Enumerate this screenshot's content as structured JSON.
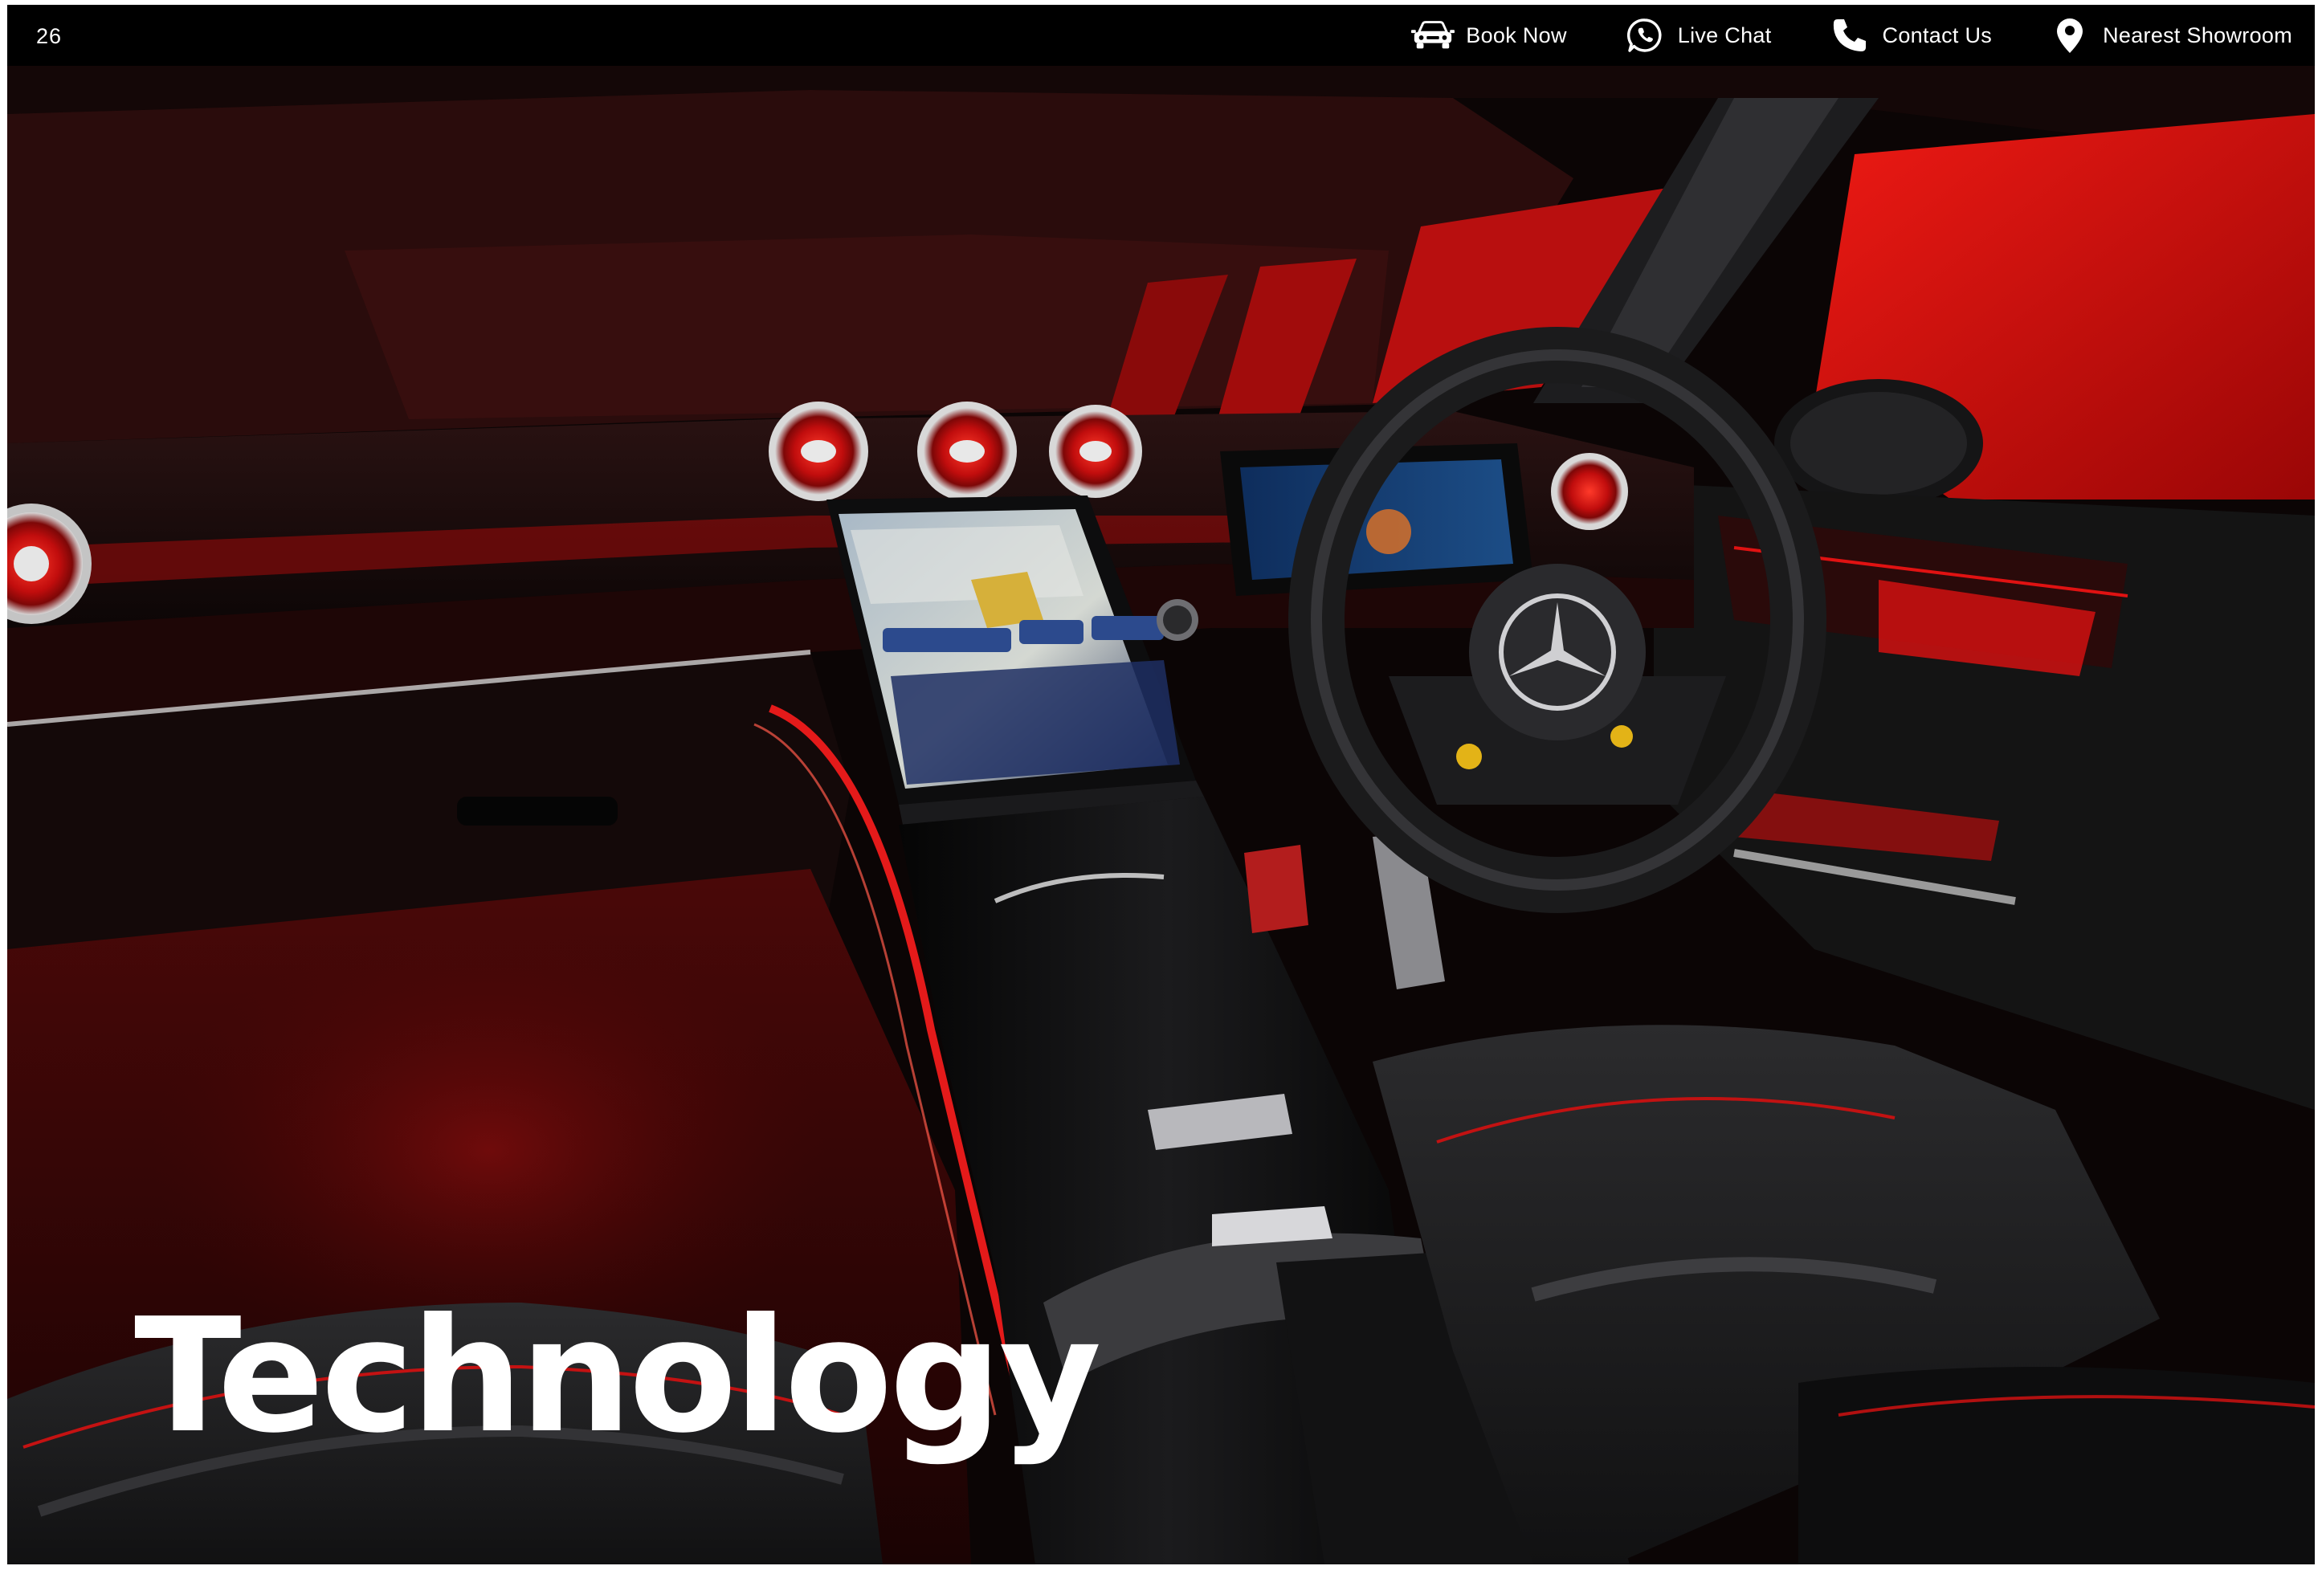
{
  "page": {
    "number": "26",
    "headline": "Technology"
  },
  "nav": [
    {
      "label": "Book Now",
      "icon": "car-icon"
    },
    {
      "label": "Live Chat",
      "icon": "whatsapp-icon"
    },
    {
      "label": "Contact Us",
      "icon": "phone-icon"
    },
    {
      "label": "Nearest Showroom",
      "icon": "location-pin-icon"
    }
  ],
  "colors": {
    "background": "#000000",
    "accent_red": "#c4100f",
    "text": "#ffffff"
  }
}
